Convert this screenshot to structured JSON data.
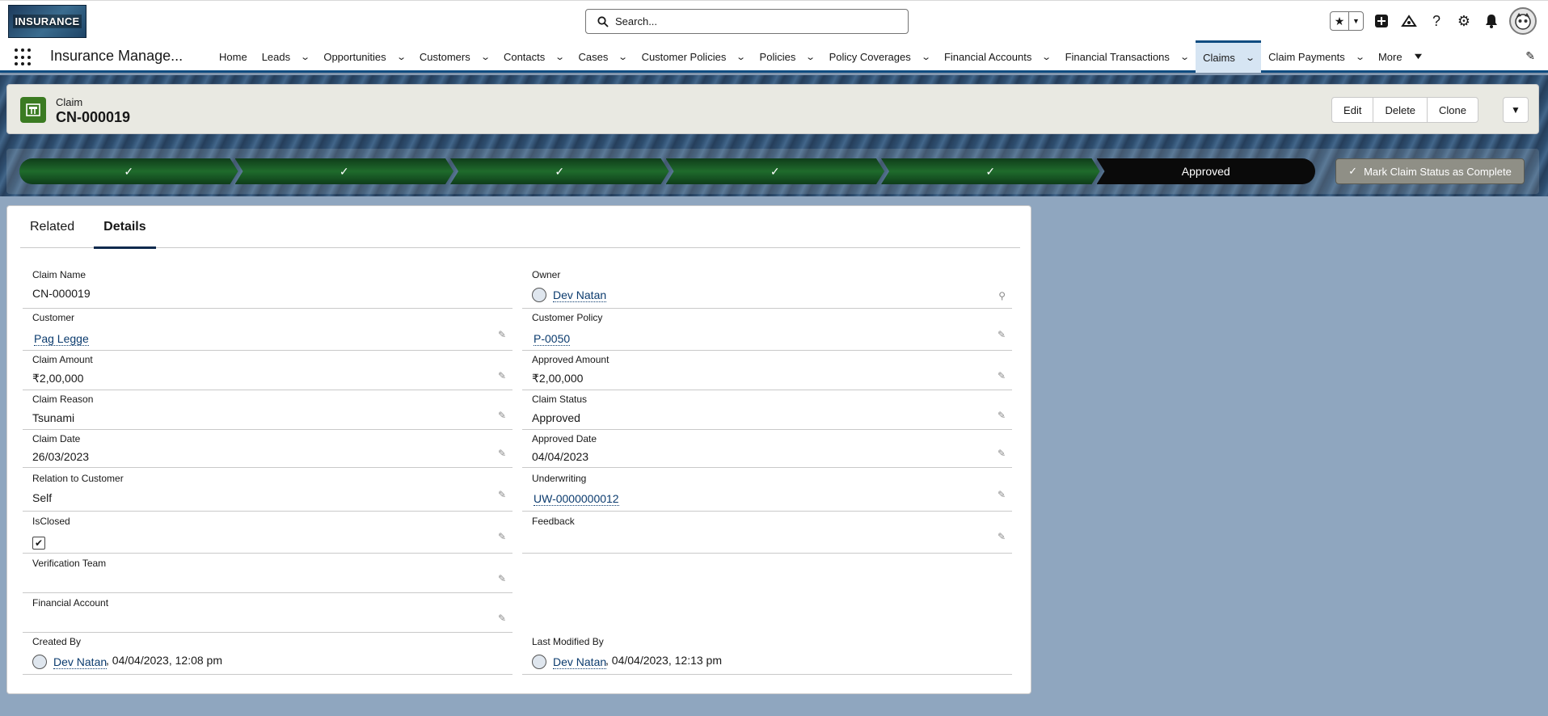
{
  "header": {
    "logo_text": "INSURANCE",
    "search_placeholder": "Search..."
  },
  "nav": {
    "app_name": "Insurance Manage...",
    "items": [
      {
        "label": "Home",
        "chevron": false
      },
      {
        "label": "Leads",
        "chevron": true
      },
      {
        "label": "Opportunities",
        "chevron": true
      },
      {
        "label": "Customers",
        "chevron": true
      },
      {
        "label": "Contacts",
        "chevron": true
      },
      {
        "label": "Cases",
        "chevron": true
      },
      {
        "label": "Customer Policies",
        "chevron": true
      },
      {
        "label": "Policies",
        "chevron": true
      },
      {
        "label": "Policy Coverages",
        "chevron": true
      },
      {
        "label": "Financial Accounts",
        "chevron": true
      },
      {
        "label": "Financial Transactions",
        "chevron": true
      },
      {
        "label": "Claims",
        "chevron": true,
        "active": true
      },
      {
        "label": "Claim Payments",
        "chevron": true
      },
      {
        "label": "More",
        "chevron": true
      }
    ]
  },
  "record": {
    "type": "Claim",
    "title": "CN-000019",
    "actions": [
      "Edit",
      "Delete",
      "Clone"
    ]
  },
  "path": {
    "current_stage": "Approved",
    "completed_steps": 5,
    "mark_button": "Mark Claim Status as Complete"
  },
  "tabs": [
    {
      "label": "Related",
      "active": false
    },
    {
      "label": "Details",
      "active": true
    }
  ],
  "fields": {
    "claim_name": {
      "label": "Claim Name",
      "value": "CN-000019"
    },
    "owner": {
      "label": "Owner",
      "value": "Dev Natan"
    },
    "customer": {
      "label": "Customer",
      "value": "Pag Legge"
    },
    "customer_policy": {
      "label": "Customer Policy",
      "value": "P-0050"
    },
    "claim_amount": {
      "label": "Claim Amount",
      "value": "₹2,00,000"
    },
    "approved_amount": {
      "label": "Approved Amount",
      "value": "₹2,00,000"
    },
    "claim_reason": {
      "label": "Claim Reason",
      "value": "Tsunami"
    },
    "claim_status": {
      "label": "Claim Status",
      "value": "Approved"
    },
    "claim_date": {
      "label": "Claim Date",
      "value": "26/03/2023"
    },
    "approved_date": {
      "label": "Approved Date",
      "value": "04/04/2023"
    },
    "relation": {
      "label": "Relation to Customer",
      "value": "Self"
    },
    "underwriting": {
      "label": "Underwriting",
      "value": "UW-0000000012"
    },
    "is_closed": {
      "label": "IsClosed",
      "checked": true
    },
    "feedback": {
      "label": "Feedback",
      "value": ""
    },
    "verification_team": {
      "label": "Verification Team",
      "value": ""
    },
    "financial_account": {
      "label": "Financial Account",
      "value": ""
    },
    "created_by": {
      "label": "Created By",
      "user": "Dev Natan",
      "date": ", 04/04/2023, 12:08 pm"
    },
    "last_modified_by": {
      "label": "Last Modified By",
      "user": "Dev Natan",
      "date": ", 04/04/2023, 12:13 pm"
    }
  }
}
